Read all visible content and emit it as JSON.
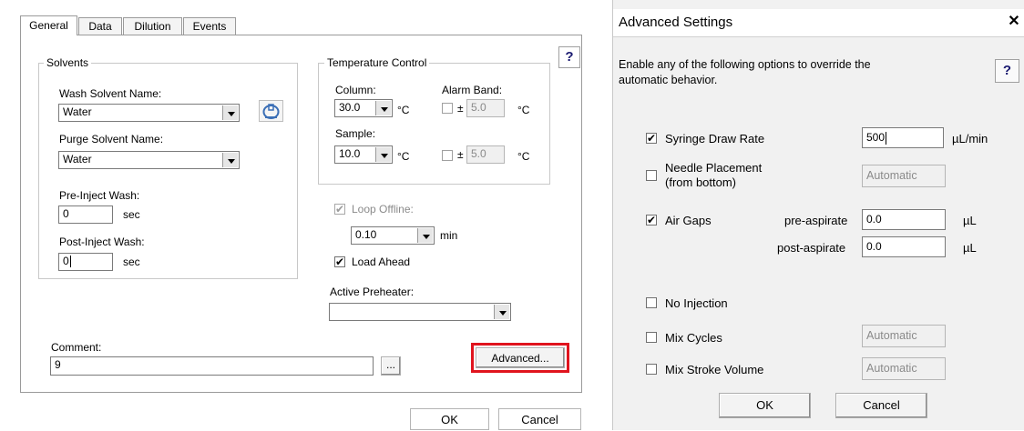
{
  "left_dialog": {
    "tabs": [
      "General",
      "Data",
      "Dilution",
      "Events"
    ],
    "help_label": "?",
    "solvents": {
      "legend": "Solvents",
      "wash_label": "Wash Solvent Name:",
      "wash_value": "Water",
      "purge_label": "Purge Solvent Name:",
      "purge_value": "Water",
      "pre_inject_label": "Pre-Inject Wash:",
      "pre_inject_value": "0",
      "pre_inject_unit": "sec",
      "post_inject_label": "Post-Inject Wash:",
      "post_inject_value": "0",
      "post_inject_unit": "sec"
    },
    "temperature": {
      "legend": "Temperature Control",
      "column_label": "Column:",
      "column_value": "30.0",
      "column_unit": "°C",
      "alarm_label": "Alarm Band:",
      "alarm_pm": "±",
      "alarm_col_value": "5.0",
      "alarm_col_unit": "°C",
      "sample_label": "Sample:",
      "sample_value": "10.0",
      "sample_unit": "°C",
      "alarm_sample_value": "5.0",
      "alarm_sample_unit": "°C"
    },
    "loop_offline_label": "Loop Offline:",
    "loop_value": "0.10",
    "loop_unit": "min",
    "load_ahead_label": "Load Ahead",
    "active_preheater_label": "Active Preheater:",
    "active_preheater_value": "",
    "comment_label": "Comment:",
    "comment_value": "9",
    "ellipsis_label": "...",
    "advanced_label": "Advanced...",
    "ok_label": "OK",
    "cancel_label": "Cancel",
    "highlight_color": "#e0141e"
  },
  "advanced_dialog": {
    "title": "Advanced Settings",
    "close_label": "✕",
    "help_label": "?",
    "description": "Enable any of the following options to override the automatic behavior.",
    "syringe_label": "Syringe Draw Rate",
    "syringe_value": "500",
    "syringe_unit": "µL/min",
    "needle_label_1": "Needle Placement",
    "needle_label_2": "(from bottom)",
    "needle_value": "Automatic",
    "air_gaps_label": "Air Gaps",
    "pre_aspirate_label": "pre-aspirate",
    "pre_aspirate_value": "0.0",
    "pre_aspirate_unit": "µL",
    "post_aspirate_label": "post-aspirate",
    "post_aspirate_value": "0.0",
    "post_aspirate_unit": "µL",
    "no_injection_label": "No Injection",
    "mix_cycles_label": "Mix Cycles",
    "mix_cycles_value": "Automatic",
    "mix_stroke_label": "Mix Stroke Volume",
    "mix_stroke_value": "Automatic",
    "ok_label": "OK",
    "cancel_label": "Cancel"
  }
}
